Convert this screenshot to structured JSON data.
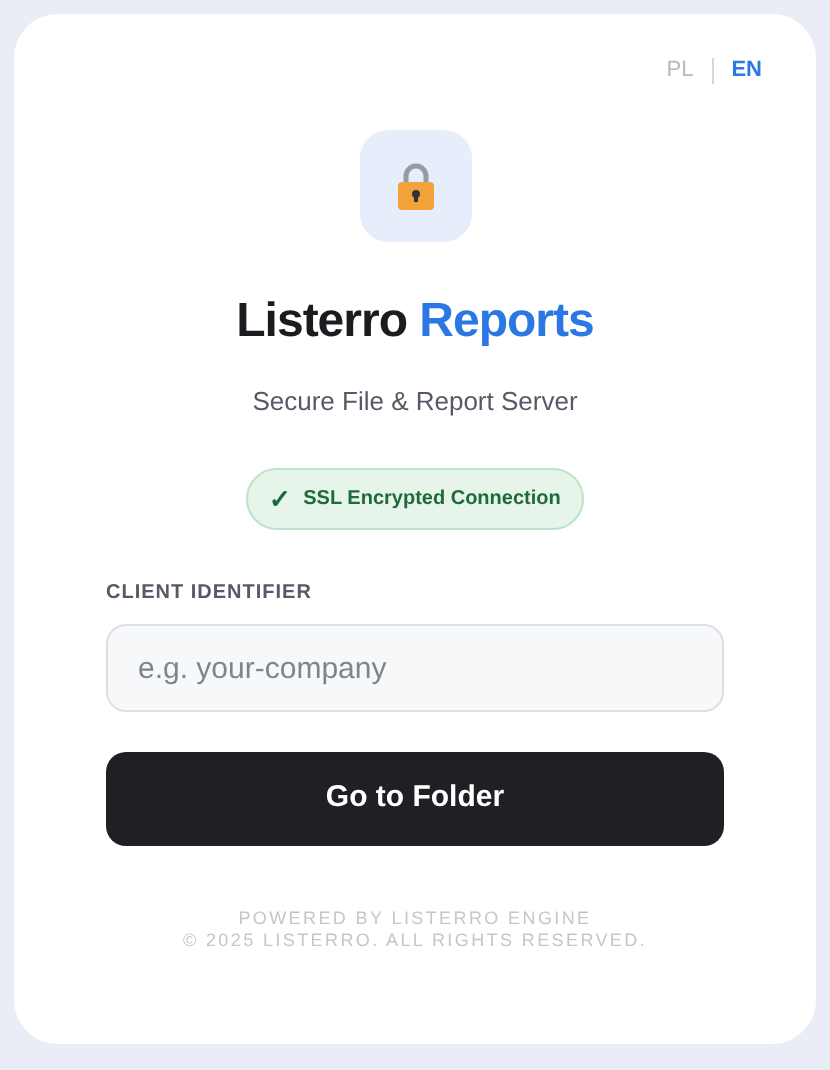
{
  "languages": [
    {
      "label": "PL",
      "selected": false
    },
    {
      "label": "EN",
      "selected": true
    }
  ],
  "brand": {
    "first": "Listerro",
    "second": "Reports"
  },
  "subtitle": "Secure File & Report Server",
  "badge": {
    "check": "✓",
    "label": "SSL Encrypted Connection"
  },
  "field": {
    "label": "CLIENT IDENTIFIER",
    "placeholder": "e.g. your-company"
  },
  "button": "Go to Folder",
  "footer": [
    "POWERED BY LISTERRO ENGINE",
    "© 2025 LISTERRO. ALL RIGHTS RESERVED."
  ]
}
